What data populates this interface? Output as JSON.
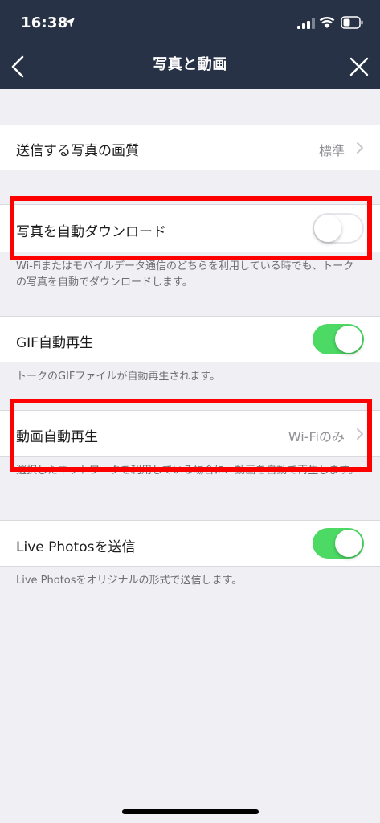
{
  "status_bar": {
    "time": "16:38"
  },
  "nav": {
    "title": "写真と動画"
  },
  "settings": {
    "photo_quality": {
      "label": "送信する写真の画質",
      "value": "標準"
    },
    "auto_download": {
      "label": "写真を自動ダウンロード",
      "enabled": false,
      "description": "Wi-Fiまたはモバイルデータ通信のどちらを利用している時でも、トークの写真を自動でダウンロードします。"
    },
    "gif_autoplay": {
      "label": "GIF自動再生",
      "enabled": true,
      "description": "トークのGIFファイルが自動再生されます。"
    },
    "video_autoplay": {
      "label": "動画自動再生",
      "value": "Wi-Fiのみ",
      "description": "選択したネットワークを利用している場合に、動画を自動で再生します。"
    },
    "live_photos": {
      "label": "Live Photosを送信",
      "enabled": true,
      "description": "Live Photosをオリジナルの形式で送信します。"
    }
  },
  "colors": {
    "header_bg": "#283246",
    "toggle_on": "#4cd964",
    "highlight": "#ff0000"
  }
}
